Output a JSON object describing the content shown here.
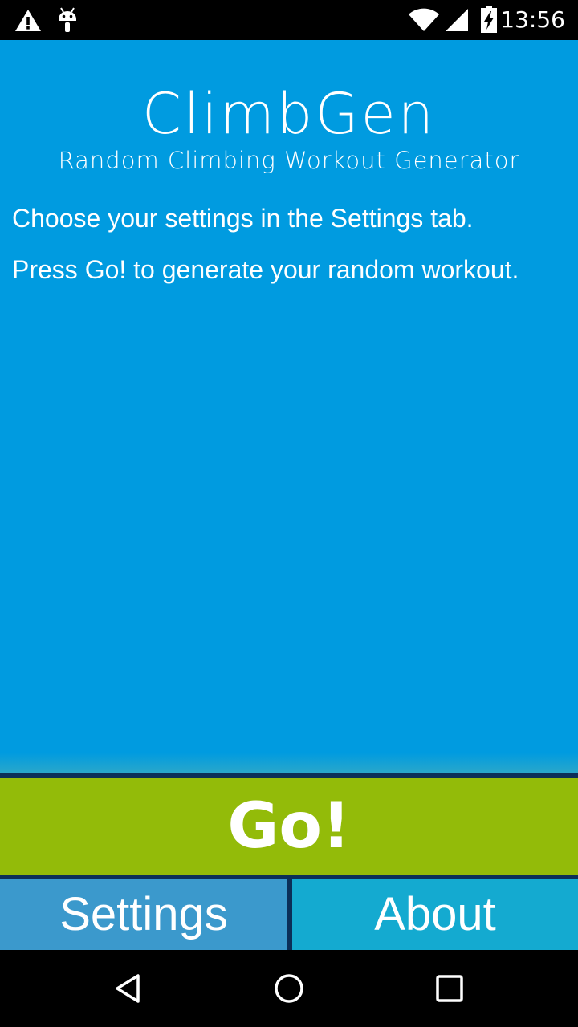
{
  "status_bar": {
    "time": "13:56",
    "icons": [
      "warning-icon",
      "android-debug-icon",
      "wifi-icon",
      "cell-signal-icon",
      "battery-charging-icon"
    ]
  },
  "app": {
    "title": "ClimbGen",
    "subtitle": "Random Climbing Workout Generator",
    "instructions": [
      "Choose your settings in the Settings tab.",
      "Press Go! to generate your random workout."
    ]
  },
  "actions": {
    "go_label": "Go!"
  },
  "tabs": [
    {
      "label": "Settings"
    },
    {
      "label": "About"
    }
  ],
  "nav_bar": {
    "buttons": [
      "back-icon",
      "home-icon",
      "recents-icon"
    ]
  },
  "colors": {
    "background": "#009be0",
    "go_button": "#93bb09",
    "settings_tab": "#3b99cc",
    "about_tab": "#14aad0",
    "divider": "#0b2f58"
  }
}
